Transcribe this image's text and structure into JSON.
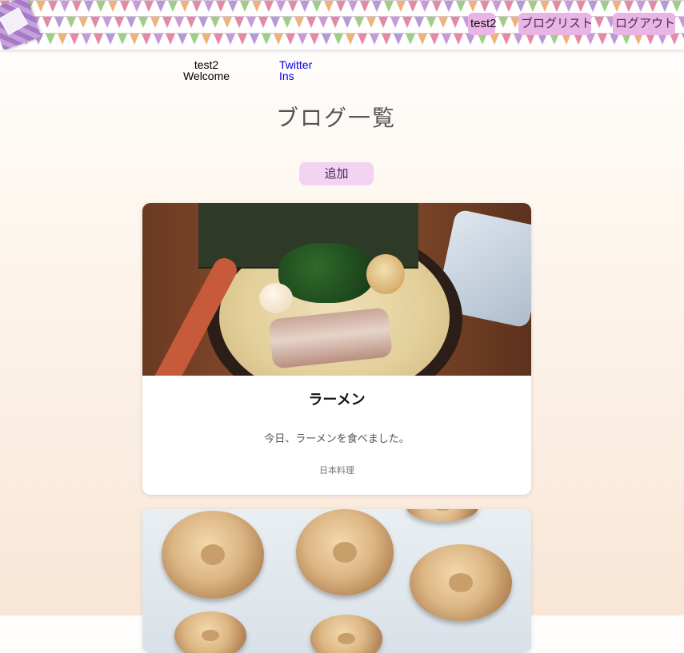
{
  "header": {
    "nav": {
      "user": "test2",
      "blog_list": "ブログリスト",
      "logout": "ログアウト"
    }
  },
  "profile": {
    "username": "test2",
    "greeting": "Welcome"
  },
  "social_links": {
    "twitter": "Twitter",
    "ins": "Ins"
  },
  "page": {
    "title": "ブログ一覧",
    "add_button": "追加"
  },
  "posts": [
    {
      "title": "ラーメン",
      "description": "今日、ラーメンを食べました。",
      "category": "日本料理",
      "image": "ramen-photo"
    },
    {
      "image": "baked-cookies-photo"
    }
  ],
  "colors": {
    "nav_button_bg": "#e8b5e5",
    "add_button_bg": "#f3d3f2",
    "link": "#0000ee",
    "page_bg_top": "#fffdfb",
    "page_bg_bottom": "#f8e6d6"
  }
}
